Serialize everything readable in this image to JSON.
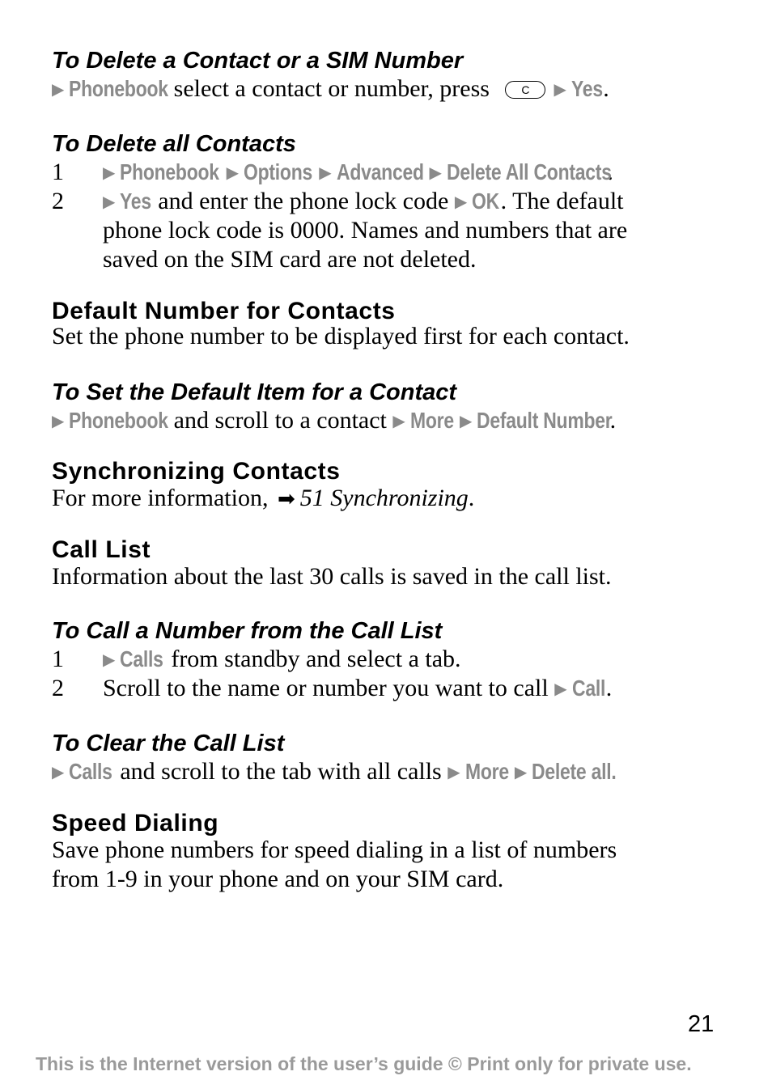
{
  "sections": {
    "delete_contact": {
      "heading": "To Delete a Contact or a SIM Number",
      "menu1": "Phonebook",
      "text1": " select a contact or number, press ",
      "key": "C",
      "menu2": "Yes",
      "end": "."
    },
    "delete_all": {
      "heading": "To Delete all Contacts",
      "step1": {
        "num": "1",
        "m1": "Phonebook",
        "m2": "Options",
        "m3": "Advanced",
        "m4": "Delete All Contacts",
        "end": "."
      },
      "step2": {
        "num": "2",
        "m1": "Yes",
        "t1": " and enter the phone lock code ",
        "m2": "OK",
        "t2": ". The default",
        "line2": "phone lock code is 0000. Names and numbers that are",
        "line3": "saved on the SIM card are not deleted."
      }
    },
    "default_number": {
      "heading": "Default Number for Contacts",
      "text": "Set the phone number to be displayed first for each contact."
    },
    "set_default": {
      "heading": "To Set the Default Item for a Contact",
      "m1": "Phonebook",
      "t1": " and scroll to a contact ",
      "m2": "More",
      "m3": "Default Number",
      "end": "."
    },
    "sync": {
      "heading": "Synchronizing Contacts",
      "text": "For more information, ",
      "ref": "51 Synchronizing",
      "end": "."
    },
    "call_list": {
      "heading": "Call List",
      "text": "Information about the last 30 calls is saved in the call list."
    },
    "call_number": {
      "heading": "To Call a Number from the Call List",
      "step1": {
        "num": "1",
        "m1": "Calls",
        "t1": " from standby and select a tab."
      },
      "step2": {
        "num": "2",
        "t1": "Scroll to the name or number you want to call ",
        "m1": "Call",
        "end": "."
      }
    },
    "clear_list": {
      "heading": "To Clear the Call List",
      "m1": "Calls",
      "t1": " and scroll to the tab with all calls ",
      "m2": "More",
      "m3": "Delete all."
    },
    "speed_dial": {
      "heading": "Speed Dialing",
      "line1": "Save phone numbers for speed dialing in a list of numbers",
      "line2": "from 1-9 in your phone and on your SIM card."
    }
  },
  "page_number": "21",
  "footer": "This is the Internet version of the user’s guide © Print only for private use.",
  "icons": {
    "menu_arrow": "▶",
    "reference_arrow": "➡"
  }
}
